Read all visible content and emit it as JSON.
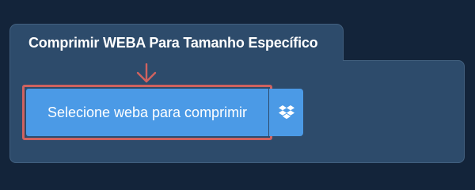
{
  "tab": {
    "title": "Comprimir WEBA Para Tamanho Específico"
  },
  "upload": {
    "select_label": "Selecione weba para comprimir",
    "dropbox_icon": "dropbox-icon"
  },
  "colors": {
    "page_background": "#13243a",
    "panel_background": "#2d4b6b",
    "button_background": "#4b9ae6",
    "highlight_border": "#d0625f"
  }
}
